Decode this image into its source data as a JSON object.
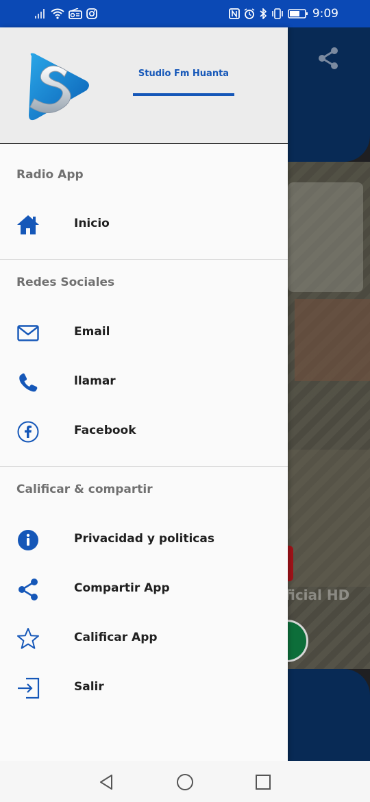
{
  "status_bar": {
    "time": "9:09"
  },
  "header": {
    "station_name": "Studio Fm Huanta"
  },
  "background": {
    "ghost_text": "ficial HD"
  },
  "sections": [
    {
      "title": "Radio App",
      "items": [
        {
          "label": "Inicio",
          "icon": "home-icon"
        }
      ]
    },
    {
      "title": "Redes Sociales",
      "items": [
        {
          "label": "Email",
          "icon": "email-icon"
        },
        {
          "label": "llamar",
          "icon": "phone-icon"
        },
        {
          "label": "Facebook",
          "icon": "facebook-icon"
        }
      ]
    },
    {
      "title": "Calificar & compartir",
      "items": [
        {
          "label": "Privacidad y politicas",
          "icon": "info-icon"
        },
        {
          "label": "Compartir App",
          "icon": "share-icon"
        },
        {
          "label": "Calificar App",
          "icon": "star-icon"
        },
        {
          "label": "Salir",
          "icon": "exit-icon"
        }
      ]
    }
  ],
  "colors": {
    "accent": "#1557b8",
    "status_bar": "#0b49b5",
    "app_dark": "#082a55"
  }
}
